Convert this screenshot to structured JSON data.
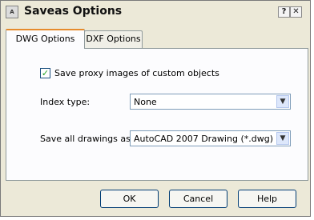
{
  "window": {
    "title": "Saveas Options",
    "icon": "autocad-app-icon",
    "icon_text": "A",
    "help_glyph": "?",
    "close_glyph": "✕"
  },
  "tabs": [
    {
      "label": "DWG Options",
      "selected": true
    },
    {
      "label": "DXF Options",
      "selected": false
    }
  ],
  "options": {
    "proxy_checkbox": {
      "label": "Save proxy images of custom objects",
      "checked": true,
      "check_glyph": "✓"
    },
    "index_type": {
      "label": "Index type:",
      "value": "None"
    },
    "save_format": {
      "label": "Save all drawings as:",
      "value": "AutoCAD 2007 Drawing (*.dwg)"
    }
  },
  "buttons": {
    "ok": "OK",
    "cancel": "Cancel",
    "help": "Help"
  },
  "dropdown_glyph": "▼"
}
